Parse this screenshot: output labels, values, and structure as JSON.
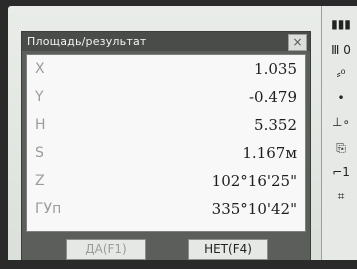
{
  "dialog": {
    "title": "Площадь/результат",
    "close_glyph": "×",
    "rows": [
      {
        "label": "X",
        "value": "1.035"
      },
      {
        "label": "Y",
        "value": "-0.479"
      },
      {
        "label": "H",
        "value": "5.352"
      },
      {
        "label": "S",
        "value": "1.167м"
      },
      {
        "label": "Z",
        "value": "102°16'25\""
      },
      {
        "label": "ГУп",
        "value": "335°10'42\""
      }
    ],
    "buttons": {
      "yes": "ДА(F1)",
      "no": "НЕТ(F4)"
    }
  },
  "status_bar": {
    "battery_glyph": "▮▮▮",
    "indicator_1": "Ⅲ  0",
    "indicator_2": "⸗⁰",
    "indicator_3": "•",
    "indicator_4": "⊥∘",
    "indicator_5": "⎘",
    "indicator_6": "⌐1",
    "indicator_7": "⌗"
  }
}
